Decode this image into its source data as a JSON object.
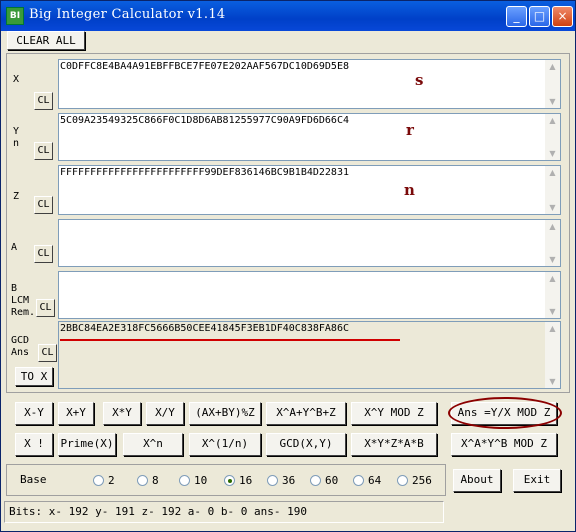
{
  "window": {
    "title": "Big Integer Calculator v1.14",
    "icon_text": "BI",
    "min_glyph": "_",
    "max_glyph": "□",
    "close_glyph": "×"
  },
  "toolbar": {
    "clear_all": "CLEAR ALL"
  },
  "fields": {
    "x": {
      "label": "X",
      "cl": "CL",
      "value": "C0DFFC8E4BA4A91EBFFBCE7FE07E202AAF567DC10D69D5E8",
      "note": "s"
    },
    "y": {
      "label": "Y\nn",
      "cl": "CL",
      "value": "5C09A23549325C866F0C1D8D6AB81255977C90A9FD6D66C4",
      "note": "r"
    },
    "z": {
      "label": "Z",
      "cl": "CL",
      "value": "FFFFFFFFFFFFFFFFFFFFFFFF99DEF836146BC9B1B4D22831",
      "note": "n"
    },
    "a": {
      "label": "A",
      "cl": "CL",
      "value": ""
    },
    "b": {
      "label": "B\nLCM\nRem.",
      "cl": "CL",
      "value": ""
    },
    "ans": {
      "label": "GCD\nAns",
      "cl": "CL",
      "value": "2BBC84EA2E318FC5666B50CEE41845F3EB1DF40C838FA86C",
      "to_x": "TO X"
    }
  },
  "ops_row1": [
    "X-Y",
    "X+Y",
    "X*Y",
    "X/Y",
    "(AX+BY)%Z",
    "X^A+Y^B+Z",
    "X^Y MOD Z",
    "Ans =Y/X MOD Z"
  ],
  "ops_row2": [
    "X !",
    "Prime(X)",
    "X^n",
    "X^(1/n)",
    "GCD(X,Y)",
    "X*Y*Z*A*B",
    "X^A*Y^B MOD Z"
  ],
  "base": {
    "label": "Base",
    "options": [
      "2",
      "8",
      "10",
      "16",
      "36",
      "60",
      "64",
      "256"
    ],
    "selected": "16"
  },
  "about_button": "About",
  "exit_button": "Exit",
  "status": "Bits: x- 192 y- 191 z- 192 a- 0 b- 0 ans- 190",
  "colors": {
    "title_bar": "#0050d8",
    "annotation": "#7a0a0a",
    "highlight_line": "#d00000"
  }
}
